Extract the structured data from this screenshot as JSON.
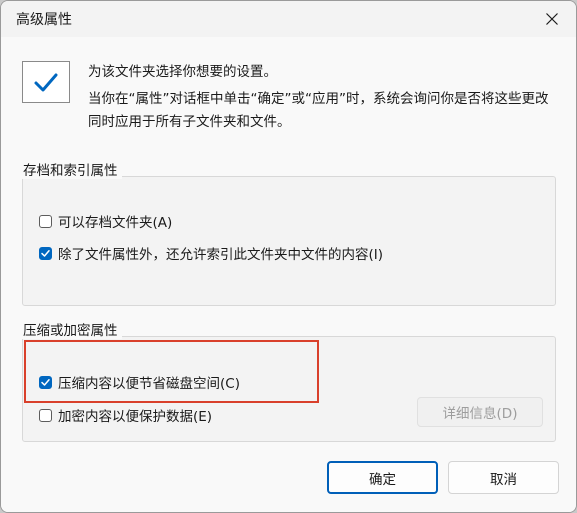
{
  "window": {
    "title": "高级属性"
  },
  "info": {
    "line1": "为该文件夹选择你想要的设置。",
    "line2": "当你在“属性”对话框中单击“确定”或“应用”时，系统会询问你是否将这些更改同时应用于所有子文件夹和文件。"
  },
  "archive_group": {
    "label": "存档和索引属性",
    "options": [
      {
        "label": "可以存档文件夹(A)",
        "checked": false
      },
      {
        "label": "除了文件属性外，还允许索引此文件夹中文件的内容(I)",
        "checked": true
      }
    ]
  },
  "compress_group": {
    "label": "压缩或加密属性",
    "options": [
      {
        "label": "压缩内容以便节省磁盘空间(C)",
        "checked": true
      },
      {
        "label": "加密内容以便保护数据(E)",
        "checked": false
      }
    ],
    "details_label": "详细信息(D)"
  },
  "buttons": {
    "ok": "确定",
    "cancel": "取消"
  },
  "colors": {
    "accent": "#0067c0",
    "highlight": "#d9402b",
    "disabled_text": "#9d9d9d"
  },
  "icons": {
    "close": "close-icon",
    "folder": "folder-check-icon",
    "checkmark": "checkmark-icon"
  }
}
